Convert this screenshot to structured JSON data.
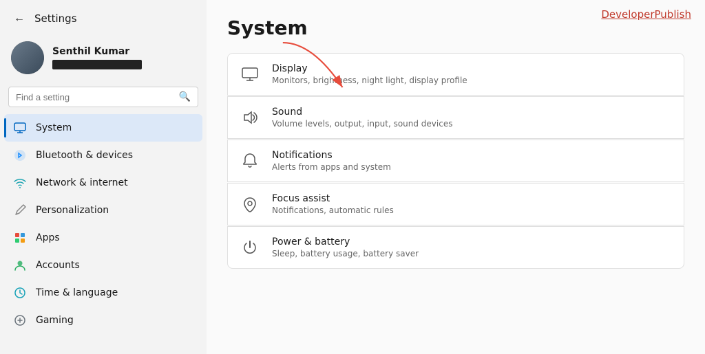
{
  "app": {
    "title": "Settings",
    "back_label": "←"
  },
  "watermark": "DeveloperPublish",
  "user": {
    "name": "Senthil Kumar",
    "email_placeholder": ""
  },
  "search": {
    "placeholder": "Find a setting"
  },
  "nav": {
    "items": [
      {
        "id": "system",
        "label": "System",
        "active": true,
        "icon": "system"
      },
      {
        "id": "bluetooth",
        "label": "Bluetooth & devices",
        "active": false,
        "icon": "bluetooth"
      },
      {
        "id": "network",
        "label": "Network & internet",
        "active": false,
        "icon": "network"
      },
      {
        "id": "personalization",
        "label": "Personalization",
        "active": false,
        "icon": "pen"
      },
      {
        "id": "apps",
        "label": "Apps",
        "active": false,
        "icon": "apps"
      },
      {
        "id": "accounts",
        "label": "Accounts",
        "active": false,
        "icon": "accounts"
      },
      {
        "id": "time",
        "label": "Time & language",
        "active": false,
        "icon": "time"
      },
      {
        "id": "gaming",
        "label": "Gaming",
        "active": false,
        "icon": "gaming"
      }
    ]
  },
  "page": {
    "title": "System",
    "settings": [
      {
        "id": "display",
        "name": "Display",
        "description": "Monitors, brightness, night light, display profile",
        "icon": "display"
      },
      {
        "id": "sound",
        "name": "Sound",
        "description": "Volume levels, output, input, sound devices",
        "icon": "sound"
      },
      {
        "id": "notifications",
        "name": "Notifications",
        "description": "Alerts from apps and system",
        "icon": "notifications"
      },
      {
        "id": "focus",
        "name": "Focus assist",
        "description": "Notifications, automatic rules",
        "icon": "focus"
      },
      {
        "id": "power",
        "name": "Power & battery",
        "description": "Sleep, battery usage, battery saver",
        "icon": "power"
      }
    ]
  }
}
